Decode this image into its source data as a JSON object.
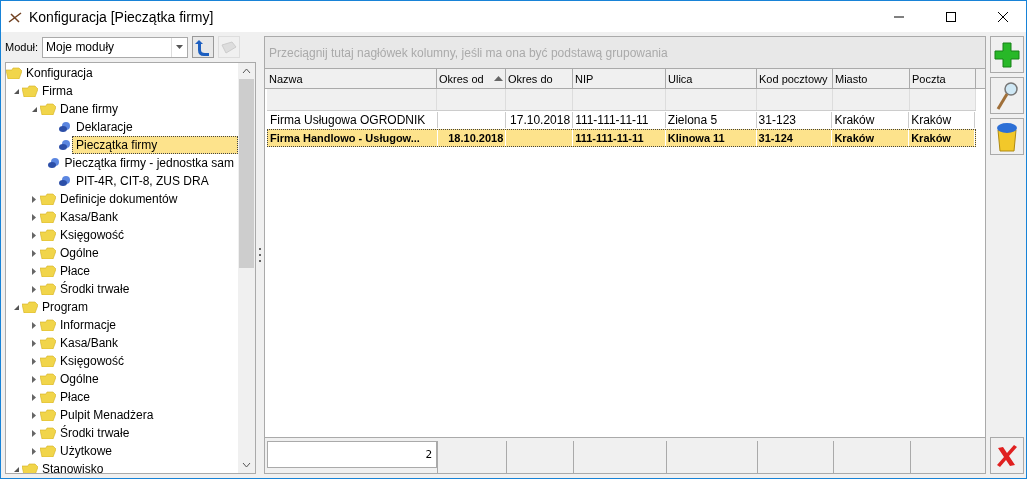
{
  "window": {
    "title": "Konfiguracja [Pieczątka firmy]"
  },
  "module": {
    "label": "Moduł:",
    "value": "Moje moduły"
  },
  "tree": [
    {
      "label": "Konfiguracja",
      "kind": "root",
      "selected": false,
      "children": [
        {
          "label": "Firma",
          "kind": "folder",
          "expanded": true,
          "selected": false,
          "children": [
            {
              "label": "Dane firmy",
              "kind": "folder",
              "expanded": true,
              "selected": false,
              "children": [
                {
                  "label": "Deklaracje",
                  "kind": "leaf",
                  "selected": false
                },
                {
                  "label": "Pieczątka firmy",
                  "kind": "leaf",
                  "selected": true
                },
                {
                  "label": "Pieczątka firmy - jednostka sam",
                  "kind": "leaf",
                  "selected": false
                },
                {
                  "label": "PIT-4R, CIT-8, ZUS DRA",
                  "kind": "leaf",
                  "selected": false
                }
              ]
            },
            {
              "label": "Definicje dokumentów",
              "kind": "folder",
              "expanded": false,
              "selected": false
            },
            {
              "label": "Kasa/Bank",
              "kind": "folder",
              "expanded": false,
              "selected": false
            },
            {
              "label": "Księgowość",
              "kind": "folder",
              "expanded": false,
              "selected": false
            },
            {
              "label": "Ogólne",
              "kind": "folder",
              "expanded": false,
              "selected": false
            },
            {
              "label": "Płace",
              "kind": "folder",
              "expanded": false,
              "selected": false
            },
            {
              "label": "Środki trwałe",
              "kind": "folder",
              "expanded": false,
              "selected": false
            }
          ]
        },
        {
          "label": "Program",
          "kind": "folder",
          "expanded": true,
          "selected": false,
          "children": [
            {
              "label": "Informacje",
              "kind": "folder",
              "expanded": false,
              "selected": false
            },
            {
              "label": "Kasa/Bank",
              "kind": "folder",
              "expanded": false,
              "selected": false
            },
            {
              "label": "Księgowość",
              "kind": "folder",
              "expanded": false,
              "selected": false
            },
            {
              "label": "Ogólne",
              "kind": "folder",
              "expanded": false,
              "selected": false
            },
            {
              "label": "Płace",
              "kind": "folder",
              "expanded": false,
              "selected": false
            },
            {
              "label": "Pulpit Menadżera",
              "kind": "folder",
              "expanded": false,
              "selected": false
            },
            {
              "label": "Środki trwałe",
              "kind": "folder",
              "expanded": false,
              "selected": false
            },
            {
              "label": "Użytkowe",
              "kind": "folder",
              "expanded": false,
              "selected": false
            }
          ]
        },
        {
          "label": "Stanowisko",
          "kind": "folder",
          "expanded": true,
          "selected": false
        }
      ]
    }
  ],
  "grid": {
    "group_hint": "Przeciągnij tutaj nagłówek kolumny, jeśli ma ona być podstawą grupowania",
    "columns": [
      {
        "label": "Nazwa",
        "sorted": false
      },
      {
        "label": "Okres od",
        "sorted": true
      },
      {
        "label": "Okres do",
        "sorted": false
      },
      {
        "label": "NIP",
        "sorted": false
      },
      {
        "label": "Ulica",
        "sorted": false
      },
      {
        "label": "Kod pocztowy",
        "sorted": false
      },
      {
        "label": "Miasto",
        "sorted": false
      },
      {
        "label": "Poczta",
        "sorted": false
      }
    ],
    "rows": [
      {
        "selected": false,
        "cells": [
          "Firma Usługowa OGRODNIK",
          "",
          "17.10.2018",
          "111-111-11-11",
          "Zielona 5",
          "31-123",
          "Kraków",
          "Kraków"
        ]
      },
      {
        "selected": true,
        "cells": [
          "Firma Handlowo - Usługow...",
          "18.10.2018",
          "",
          "111-111-11-11",
          "Klinowa 11",
          "31-124",
          "Kraków",
          "Kraków"
        ]
      }
    ],
    "count": "2"
  }
}
